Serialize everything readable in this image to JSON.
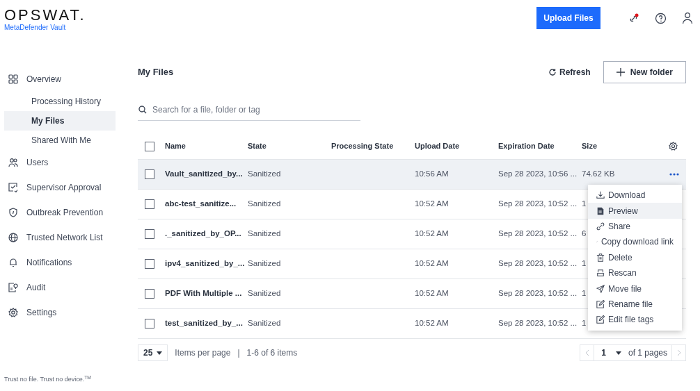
{
  "brand": {
    "logo": "OPSWAT.",
    "product": "MetaDefender Vault"
  },
  "header": {
    "upload_button": "Upload Files"
  },
  "sidebar": {
    "items": [
      {
        "label": "Overview",
        "selected": false,
        "children": [
          {
            "label": "Processing History",
            "selected": false
          },
          {
            "label": "My Files",
            "selected": true
          },
          {
            "label": "Shared With Me",
            "selected": false
          }
        ]
      },
      {
        "label": "Users",
        "selected": false
      },
      {
        "label": "Supervisor Approval",
        "selected": false
      },
      {
        "label": "Outbreak Prevention",
        "selected": false
      },
      {
        "label": "Trusted Network List",
        "selected": false
      },
      {
        "label": "Notifications",
        "selected": false
      },
      {
        "label": "Audit",
        "selected": false
      },
      {
        "label": "Settings",
        "selected": false
      }
    ],
    "footer": "Trust no file. Trust no device.$^{TM}$"
  },
  "page": {
    "title": "My Files",
    "refresh": "Refresh",
    "new_folder": "New folder"
  },
  "search": {
    "placeholder": "Search for a file, folder or tag"
  },
  "table": {
    "select_all_checked": false,
    "columns": [
      "Name",
      "State",
      "Processing State",
      "Upload Date",
      "Expiration Date",
      "Size"
    ],
    "rows": [
      {
        "checked": false,
        "highlighted": true,
        "name": "Vault_sanitized_by...",
        "state": "Sanitized",
        "upload_date": "10:56 AM",
        "expiration_date": "Sep 28 2023, 10:56 ...",
        "size": "74.62 KB"
      },
      {
        "checked": false,
        "highlighted": false,
        "name": "abc-test_sanitize...",
        "state": "Sanitized",
        "upload_date": "10:52 AM",
        "expiration_date": "Sep 28 2023, 10:52 ...",
        "size": "1"
      },
      {
        "checked": false,
        "highlighted": false,
        "name": "._sanitized_by_OP...",
        "state": "Sanitized",
        "upload_date": "10:52 AM",
        "expiration_date": "Sep 28 2023, 10:52 ...",
        "size": "6"
      },
      {
        "checked": false,
        "highlighted": false,
        "name": "ipv4_sanitized_by_...",
        "state": "Sanitized",
        "upload_date": "10:52 AM",
        "expiration_date": "Sep 28 2023, 10:52 ...",
        "size": "1"
      },
      {
        "checked": false,
        "highlighted": false,
        "name": "PDF With Multiple ...",
        "state": "Sanitized",
        "upload_date": "10:52 AM",
        "expiration_date": "Sep 28 2023, 10:52 ...",
        "size": "1"
      },
      {
        "checked": false,
        "highlighted": false,
        "name": "test_sanitized_by_...",
        "state": "Sanitized",
        "upload_date": "10:52 AM",
        "expiration_date": "Sep 28 2023, 10:52 ...",
        "size": "1"
      }
    ]
  },
  "context_menu": [
    {
      "label": "Download",
      "highlighted": false
    },
    {
      "label": "Preview",
      "highlighted": true
    },
    {
      "label": "Share",
      "highlighted": false
    },
    {
      "label": "Copy download link",
      "highlighted": false
    },
    {
      "label": "Delete",
      "highlighted": false
    },
    {
      "label": "Rescan",
      "highlighted": false
    },
    {
      "label": "Move file",
      "highlighted": false
    },
    {
      "label": "Rename file",
      "highlighted": false
    },
    {
      "label": "Edit file tags",
      "highlighted": false
    }
  ],
  "pagination": {
    "per_page": "25",
    "per_page_label": "Items per page",
    "separator": "|",
    "range": "1-6 of 6 items",
    "page": "1",
    "of_pages": "of 1 pages"
  }
}
